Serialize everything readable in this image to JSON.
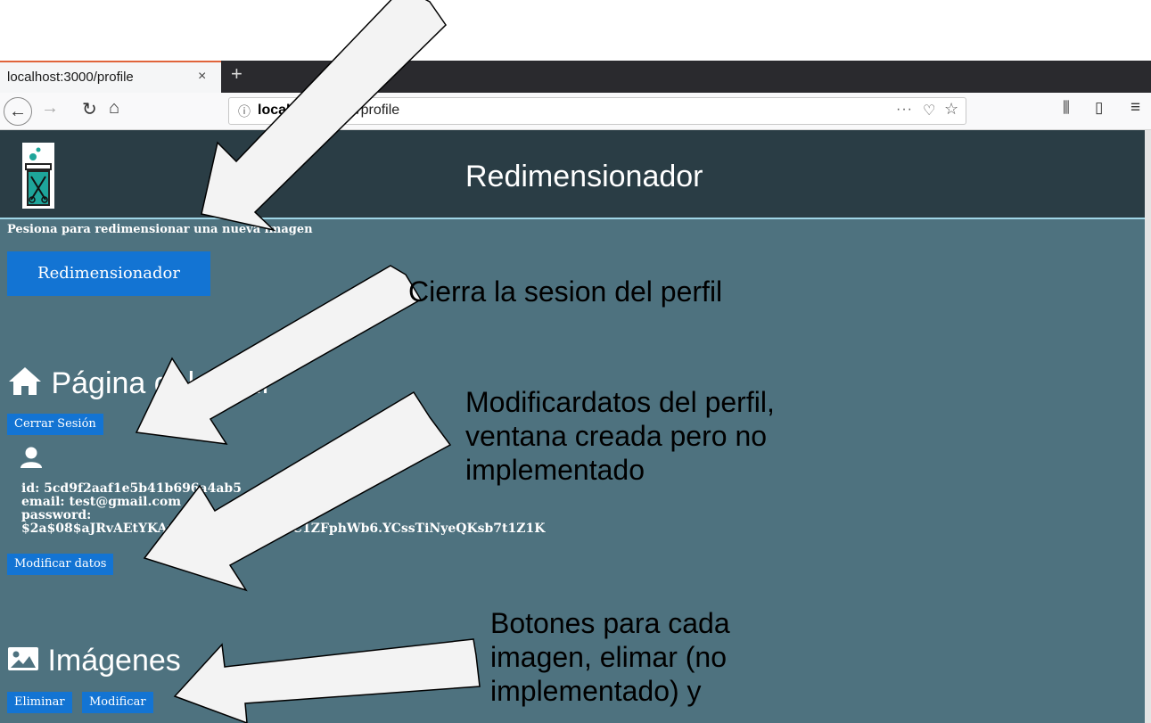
{
  "browser": {
    "tab_title": "localhost:3000/profile",
    "tab_close": "×",
    "new_tab": "+",
    "url_host": "localhost:3000",
    "url_path": "/profile",
    "url_dots": "···"
  },
  "header": {
    "title": "Redimensionador"
  },
  "resize_section": {
    "intro": "Pesiona para redimensionar una nueva imagen",
    "button": "Redimensionador"
  },
  "profile": {
    "heading": "Página del perfil",
    "logout_button": "Cerrar Sesión",
    "id_line": "id: 5cd9f2aaf1e5b41b696a4ab5",
    "email_line": "email: test@gmail.com",
    "password_label": "password:",
    "password_value": "$2a$08$aJRvAEtYKAnhBc0Pw1Lk0e62C1ZFphWb6.YCssTiNyeQKsb7t1Z1K",
    "modify_button": "Modificar datos"
  },
  "images": {
    "heading": "Imágenes",
    "delete_button": "Eliminar",
    "modify_button": "Modificar"
  },
  "annotations": {
    "logout": "Cierra la sesion del perfil",
    "modify_line1": "Modificardatos del perfil,",
    "modify_line2": "ventana creada pero no",
    "modify_line3": "implementado",
    "images_line1": "Botones para cada",
    "images_line2": "imagen, elimar (no",
    "images_line3": "implementado) y"
  }
}
